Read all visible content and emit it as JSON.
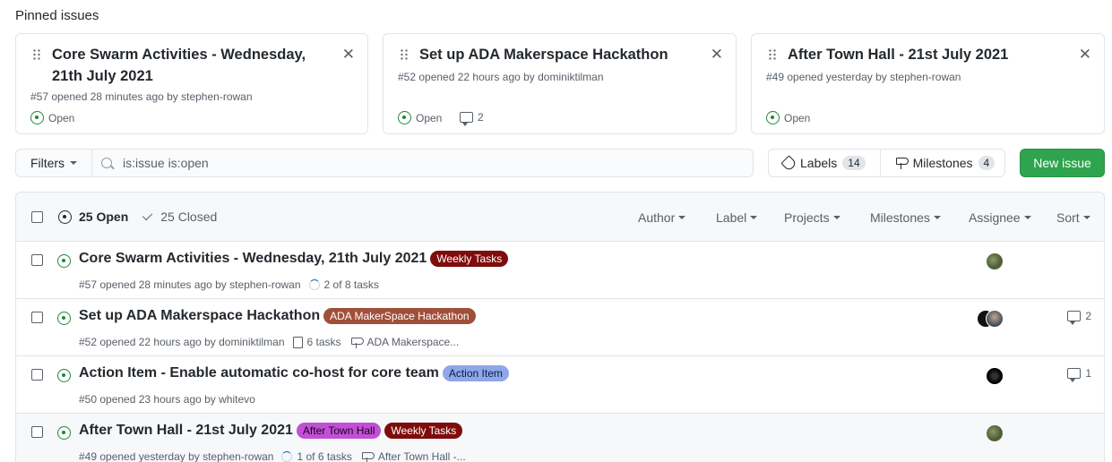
{
  "pinned": {
    "heading": "Pinned issues",
    "cards": [
      {
        "title": "Core Swarm Activities - Wednesday, 21th July 2021",
        "meta": "#57 opened 28 minutes ago by stephen-rowan",
        "state": "Open",
        "comments": ""
      },
      {
        "title": "Set up ADA Makerspace Hackathon",
        "meta": "#52 opened 22 hours ago by dominiktilman",
        "state": "Open",
        "comments": "2"
      },
      {
        "title": "After Town Hall - 21st July 2021",
        "meta": "#49 opened yesterday by stephen-rowan",
        "state": "Open",
        "comments": ""
      }
    ]
  },
  "toolbar": {
    "filters_label": "Filters",
    "search_value": "is:issue is:open",
    "labels_label": "Labels",
    "labels_count": "14",
    "milestones_label": "Milestones",
    "milestones_count": "4",
    "new_issue_label": "New issue"
  },
  "list_header": {
    "open_label": "25 Open",
    "closed_label": "25 Closed",
    "filters": [
      "Author",
      "Label",
      "Projects",
      "Milestones",
      "Assignee",
      "Sort"
    ]
  },
  "issues": [
    {
      "title": "Core Swarm Activities - Wednesday, 21th July 2021",
      "labels": [
        {
          "name": "Weekly Tasks",
          "bg": "#7f0c0c",
          "fg": "#ffffff"
        }
      ],
      "meta": "#57 opened 28 minutes ago by stephen-rowan",
      "tasks": "2 of 8 tasks",
      "milestone": "",
      "comments": ""
    },
    {
      "title": "Set up ADA Makerspace Hackathon",
      "labels": [
        {
          "name": "ADA MakerSpace Hackathon",
          "bg": "#a0503a",
          "fg": "#ffffff"
        }
      ],
      "meta": "#52 opened 22 hours ago by dominiktilman",
      "tasks": "6 tasks",
      "milestone": "ADA Makerspace...",
      "comments": "2"
    },
    {
      "title": "Action Item - Enable automatic co-host for core team",
      "labels": [
        {
          "name": "Action Item",
          "bg": "#8fa6e8",
          "fg": "#0b1f4a"
        }
      ],
      "meta": "#50 opened 23 hours ago by whitevo",
      "tasks": "",
      "milestone": "",
      "comments": "1"
    },
    {
      "title": "After Town Hall - 21st July 2021",
      "labels": [
        {
          "name": "After Town Hall",
          "bg": "#c24fd6",
          "fg": "#1b0420"
        },
        {
          "name": "Weekly Tasks",
          "bg": "#7f0c0c",
          "fg": "#ffffff"
        }
      ],
      "meta": "#49 opened yesterday by stephen-rowan",
      "tasks": "1 of 6 tasks",
      "milestone": "After Town Hall -...",
      "comments": ""
    }
  ],
  "colors": {
    "accent_green": "#2ea44f",
    "open_green": "#22863a",
    "border": "#e1e4e8"
  }
}
